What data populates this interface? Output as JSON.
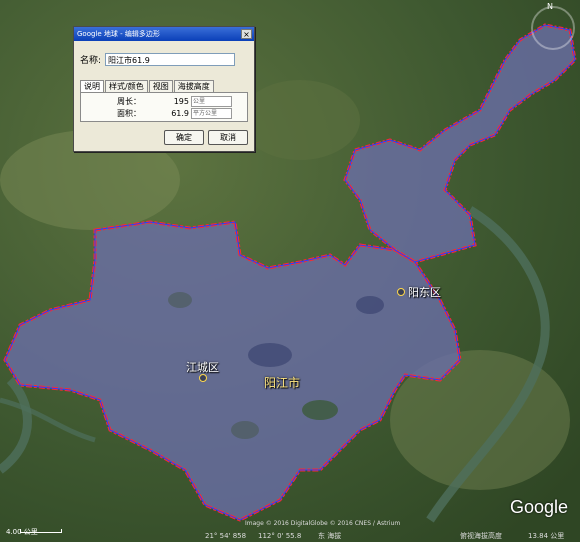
{
  "dialog": {
    "title": "Google 地球 - 编辑多边形",
    "close_label": "×",
    "name_label": "名称:",
    "name_value": "阳江市61.9",
    "tabs": [
      {
        "label": "说明"
      },
      {
        "label": "样式/颜色"
      },
      {
        "label": "视图"
      },
      {
        "label": "海拔高度"
      }
    ],
    "perimeter_label": "周长：",
    "perimeter_value": "195",
    "perimeter_unit": "公里",
    "area_label": "面积：",
    "area_value": "61.9",
    "area_unit": "平方公里",
    "ok_label": "确定",
    "cancel_label": "取消"
  },
  "places": {
    "jiangcheng": "江城区",
    "yangjiang": "阳江市",
    "yangdong": "阳东区"
  },
  "scale_label": "4.00 公里",
  "copyright": "Image © 2016 DigitalGlobe   © 2016 CNES / Astrium",
  "status": {
    "lat": "21° 54' 858",
    "lon": "112° 0' 55.8",
    "elev": "东  海拔",
    "eye": "俯视海拔高度",
    "eye_val": "13.84 公里"
  },
  "logo": "Google",
  "north": "N",
  "colors": {
    "urban": "#6a6ea8",
    "outline_red": "#ff2a2a",
    "outline_blue": "#2a3dff",
    "terrain": "#3f5a2c",
    "river": "#4a6a58"
  }
}
